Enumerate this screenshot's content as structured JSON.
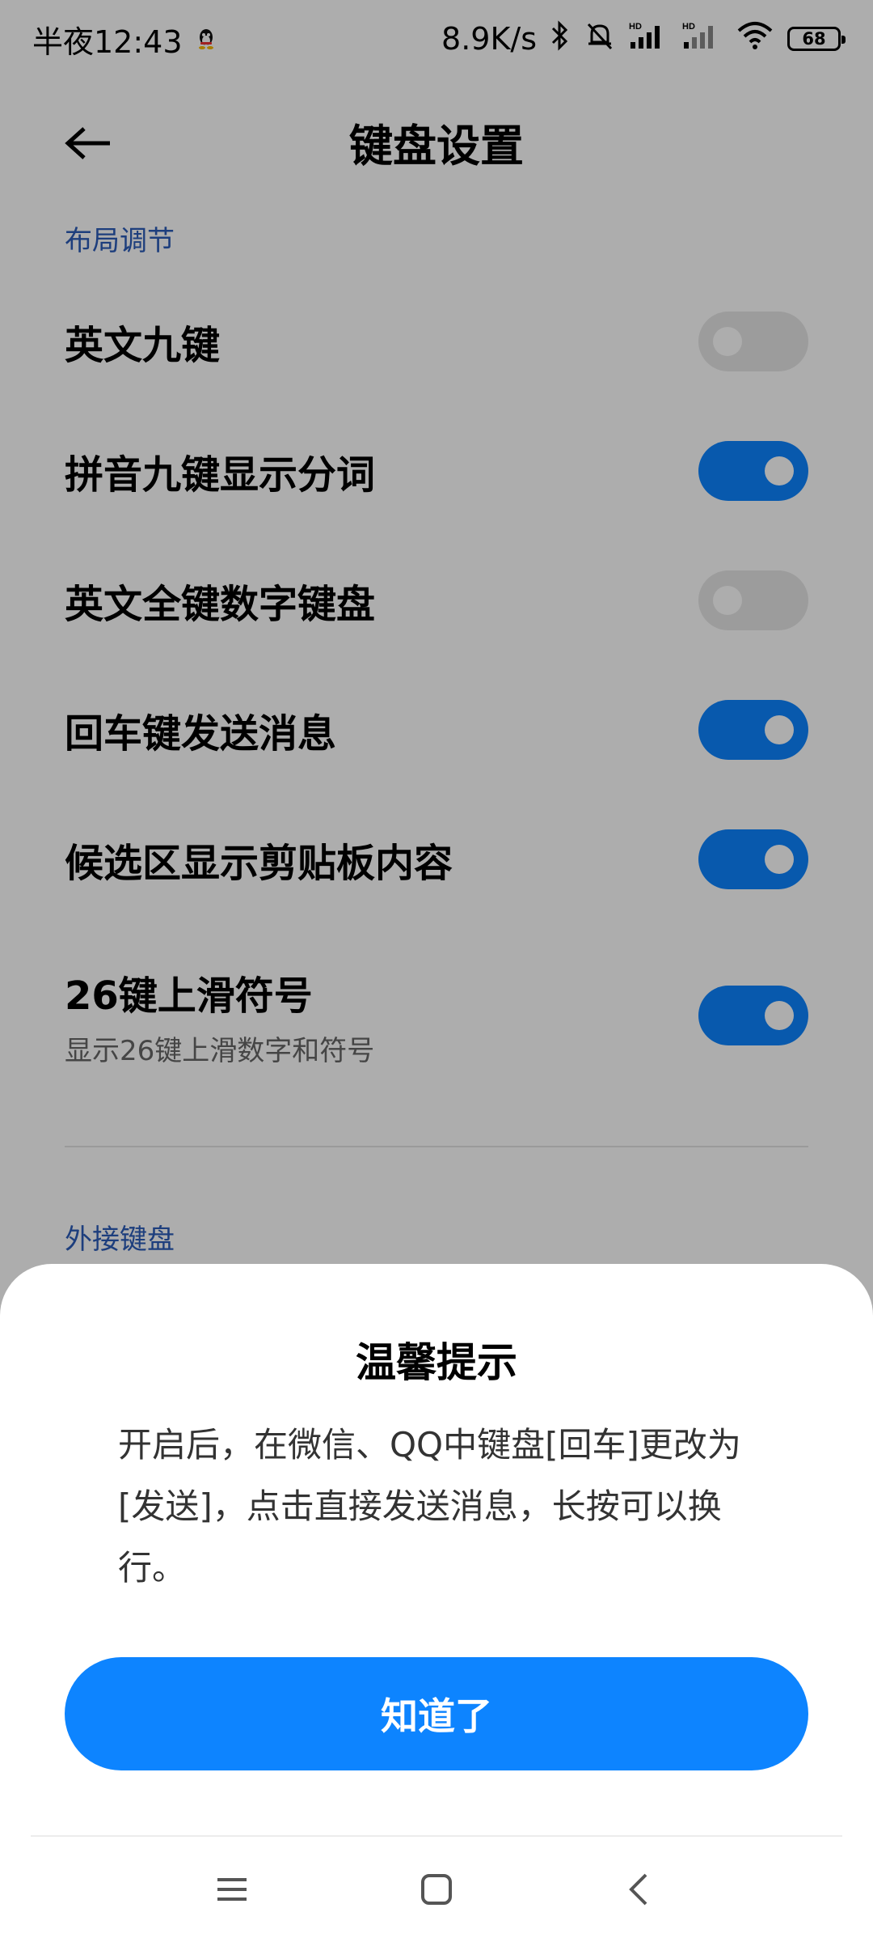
{
  "status_bar": {
    "time": "半夜12:43",
    "net_speed": "8.9K/s",
    "battery": "68"
  },
  "header": {
    "title": "键盘设置"
  },
  "sections": [
    {
      "header": "布局调节",
      "items": [
        {
          "title": "英文九键",
          "on": false
        },
        {
          "title": "拼音九键显示分词",
          "on": true
        },
        {
          "title": "英文全键数字键盘",
          "on": false
        },
        {
          "title": "回车键发送消息",
          "on": true
        },
        {
          "title": "候选区显示剪贴板内容",
          "on": true
        },
        {
          "title": "26键上滑符号",
          "subtitle": "显示26键上滑数字和符号",
          "on": true
        }
      ]
    },
    {
      "header": "外接键盘"
    }
  ],
  "dialog": {
    "title": "温馨提示",
    "message": "开启后，在微信、QQ中键盘[回车]更改为[发送]，点击直接发送消息，长按可以换行。",
    "button": "知道了"
  },
  "colors": {
    "accent": "#0d84ff",
    "section_header": "#2c5cb8",
    "overlay": "rgba(0,0,0,0.32)"
  },
  "icons": [
    "qq-icon",
    "bluetooth-icon",
    "mute-icon",
    "signal-hd-icon",
    "wifi-icon",
    "battery-icon",
    "back-arrow-icon",
    "menu-icon",
    "home-icon",
    "back-icon"
  ]
}
